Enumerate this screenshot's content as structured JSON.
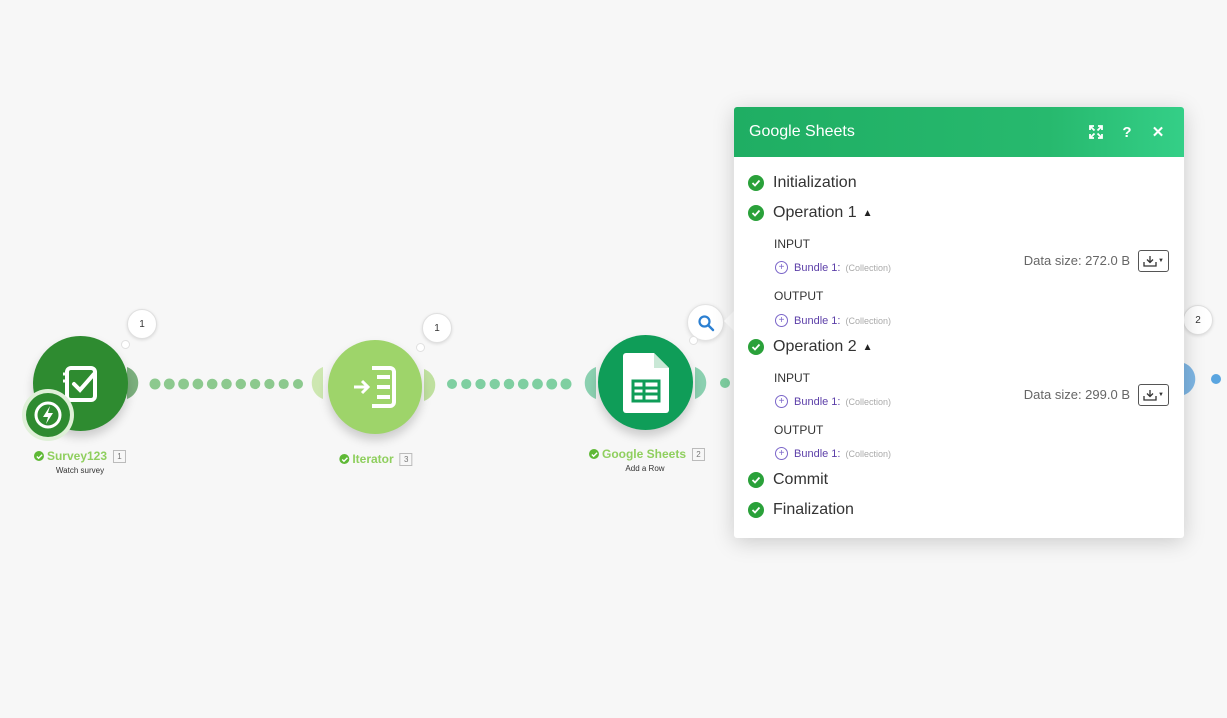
{
  "modules": [
    {
      "name": "Survey123",
      "id": "1",
      "subtitle": "Watch survey",
      "op_count": "1",
      "color": "#2e8b30"
    },
    {
      "name": "Iterator",
      "id": "3",
      "subtitle": "",
      "op_count": "1",
      "color": "#9ed46a"
    },
    {
      "name": "Google Sheets",
      "id": "2",
      "subtitle": "Add a Row",
      "op_count": "",
      "color": "#0f9d58"
    },
    {
      "name": "",
      "id": "",
      "subtitle": "",
      "op_count": "2",
      "color": "#5aa5e0"
    }
  ],
  "trigger_icon": "lightning-icon",
  "panel": {
    "title": "Google Sheets",
    "header_icons": [
      "expand-icon",
      "help-icon",
      "close-icon"
    ],
    "help_glyph": "?",
    "close_glyph": "✕",
    "items": {
      "initialization": "Initialization",
      "commit": "Commit",
      "finalization": "Finalization"
    },
    "operations": [
      {
        "label": "Operation 1",
        "data_size": "Data size: 272.0 B",
        "input_label": "INPUT",
        "input_bundle": "Bundle 1:",
        "input_type": "(Collection)",
        "output_label": "OUTPUT",
        "output_bundle": "Bundle 1:",
        "output_type": "(Collection)"
      },
      {
        "label": "Operation 2",
        "data_size": "Data size: 299.0 B",
        "input_label": "INPUT",
        "input_bundle": "Bundle 1:",
        "input_type": "(Collection)",
        "output_label": "OUTPUT",
        "output_bundle": "Bundle 1:",
        "output_type": "(Collection)"
      }
    ]
  },
  "colors": {
    "header_green": "#27b96e",
    "check_green": "#2aa13a",
    "bundle_purple": "#5c3fa8",
    "label_green": "#8fcf5e"
  }
}
